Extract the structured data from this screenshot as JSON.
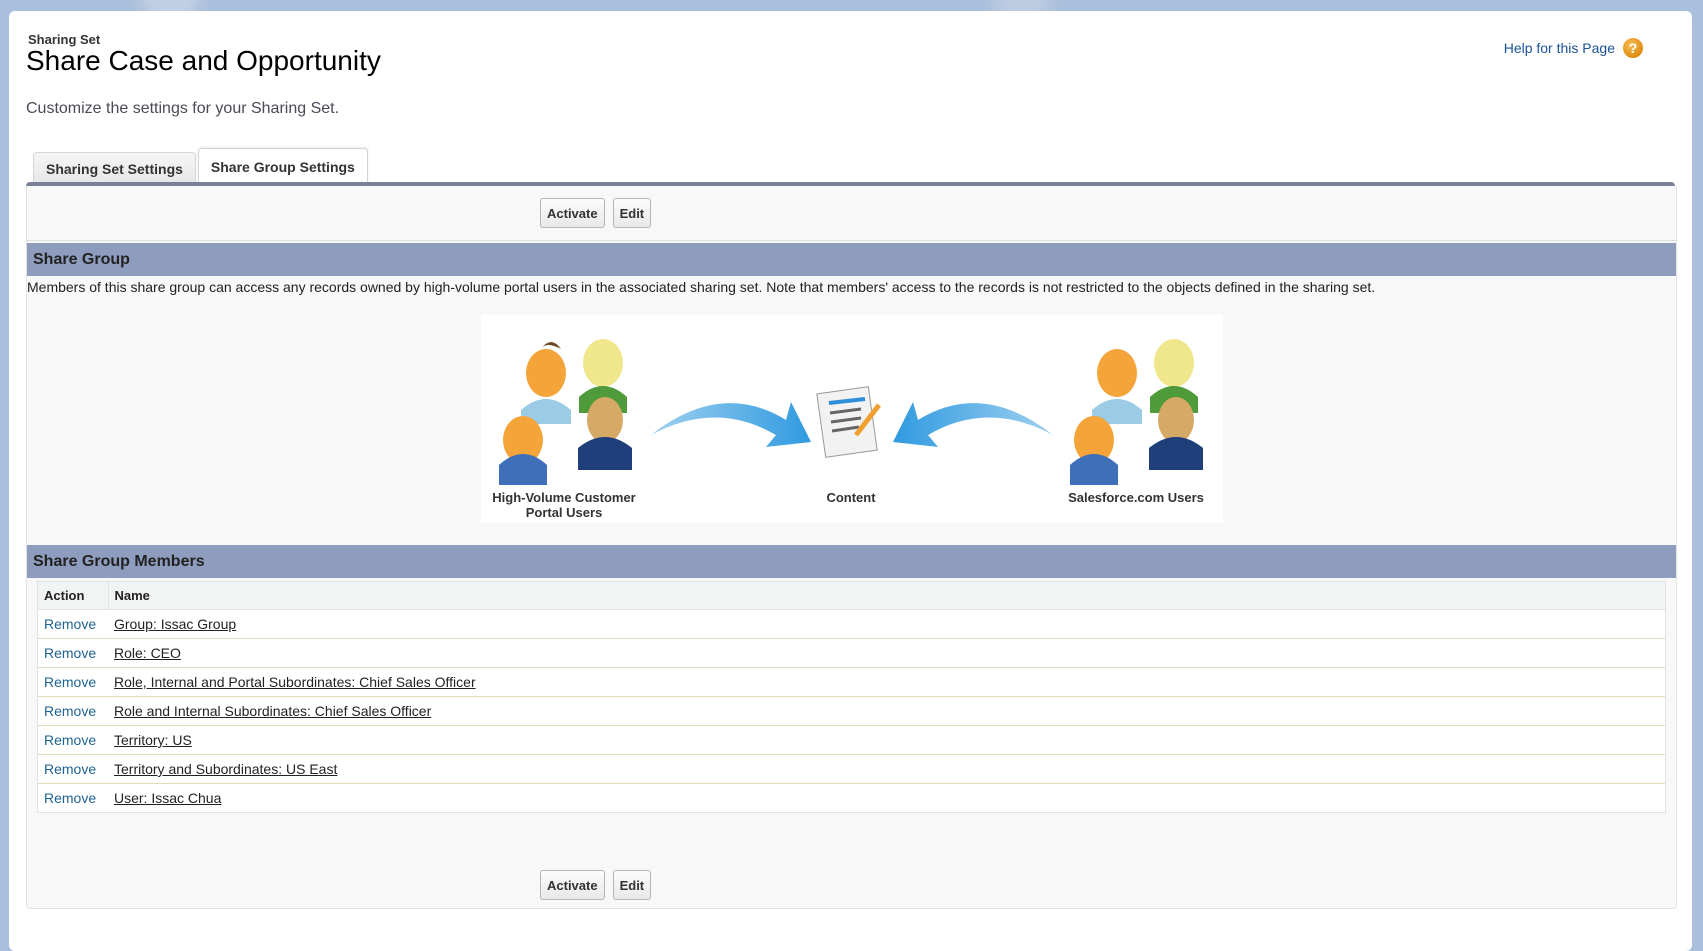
{
  "header": {
    "eyebrow": "Sharing Set",
    "title": "Share Case and Opportunity",
    "description": "Customize the settings for your Sharing Set.",
    "help_link": "Help for this Page",
    "help_icon": "question-icon"
  },
  "tabs": [
    {
      "label": "Sharing Set Settings",
      "active": false
    },
    {
      "label": "Share Group Settings",
      "active": true
    }
  ],
  "buttons": {
    "activate": "Activate",
    "edit": "Edit"
  },
  "share_group": {
    "heading": "Share Group",
    "description": "Members of this share group can access any records owned by high-volume portal users in the associated sharing set. Note that members' access to the records is not restricted to the objects defined in the sharing set.",
    "diagram": {
      "left_label_line1": "High-Volume Customer",
      "left_label_line2": "Portal Users",
      "center_label": "Content",
      "right_label": "Salesforce.com Users"
    }
  },
  "members": {
    "heading": "Share Group Members",
    "columns": [
      "Action",
      "Name"
    ],
    "rows": [
      {
        "action": "Remove",
        "name": "Group: Issac Group"
      },
      {
        "action": "Remove",
        "name": "Role: CEO"
      },
      {
        "action": "Remove",
        "name": "Role, Internal and Portal Subordinates: Chief Sales Officer"
      },
      {
        "action": "Remove",
        "name": "Role and Internal Subordinates: Chief Sales Officer"
      },
      {
        "action": "Remove",
        "name": "Territory: US"
      },
      {
        "action": "Remove",
        "name": "Territory and Subordinates: US East"
      },
      {
        "action": "Remove",
        "name": "User: Issac Chua"
      }
    ]
  },
  "colors": {
    "section_header": "#8e9dbe",
    "tab_bar": "#7a8098",
    "link": "#1f6392",
    "help_icon": "#e08b10"
  }
}
